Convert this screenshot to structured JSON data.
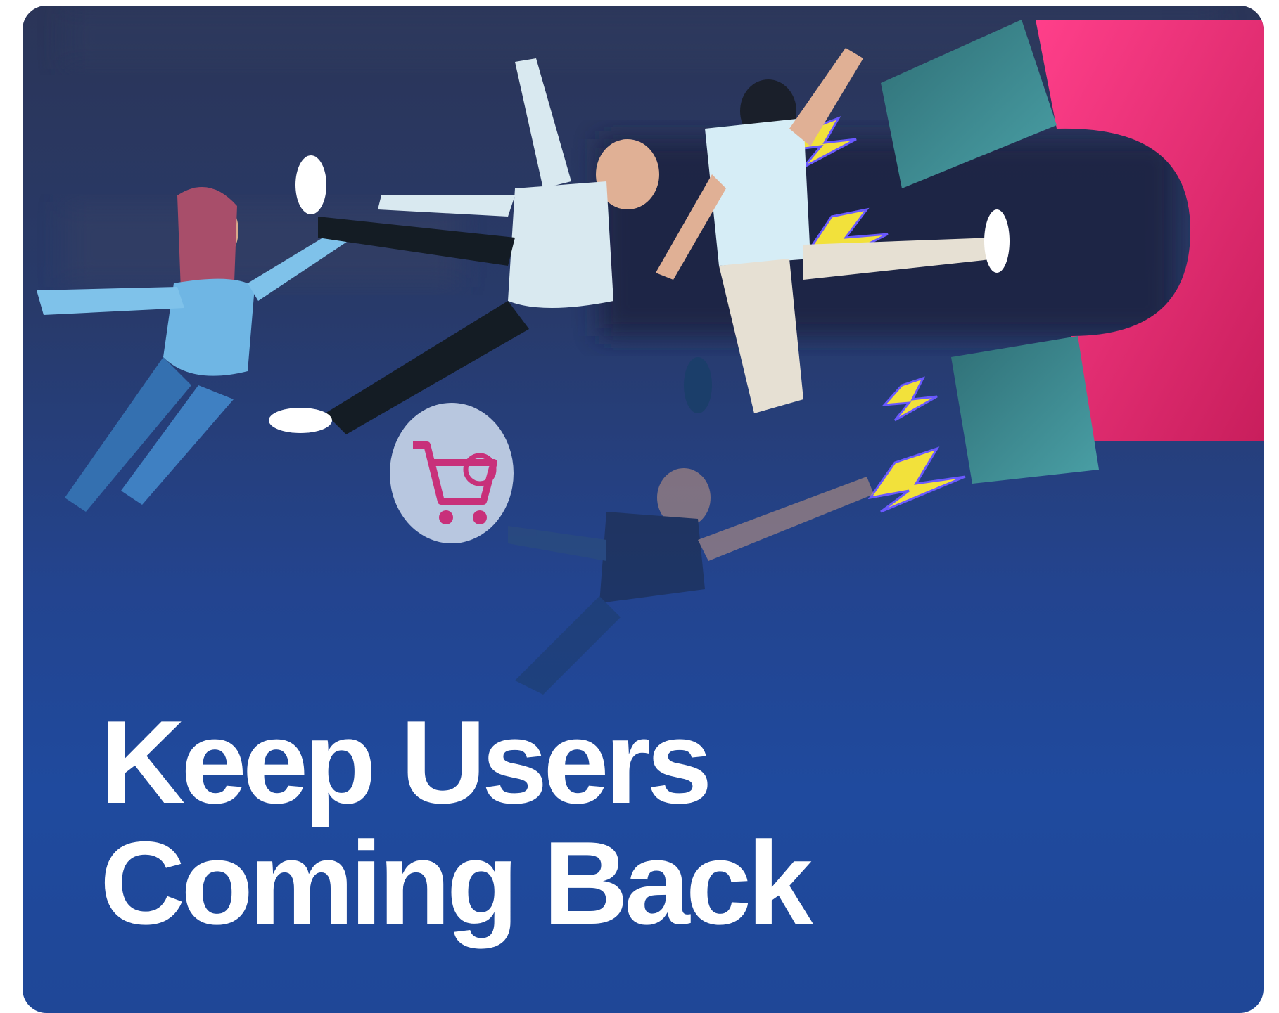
{
  "banner": {
    "headline_line1": "Keep Users",
    "headline_line2": "Coming Back",
    "colors": {
      "background_top": "#2b3558",
      "background_bottom": "#1f4a9e",
      "magnet": "#e0266e",
      "magnet_tip": "#3f8a8f",
      "lightning": "#f2e13b",
      "headline": "#ffffff"
    },
    "icons": [
      "magnet-icon",
      "shopping-cart-icon",
      "lightning-icon"
    ]
  }
}
